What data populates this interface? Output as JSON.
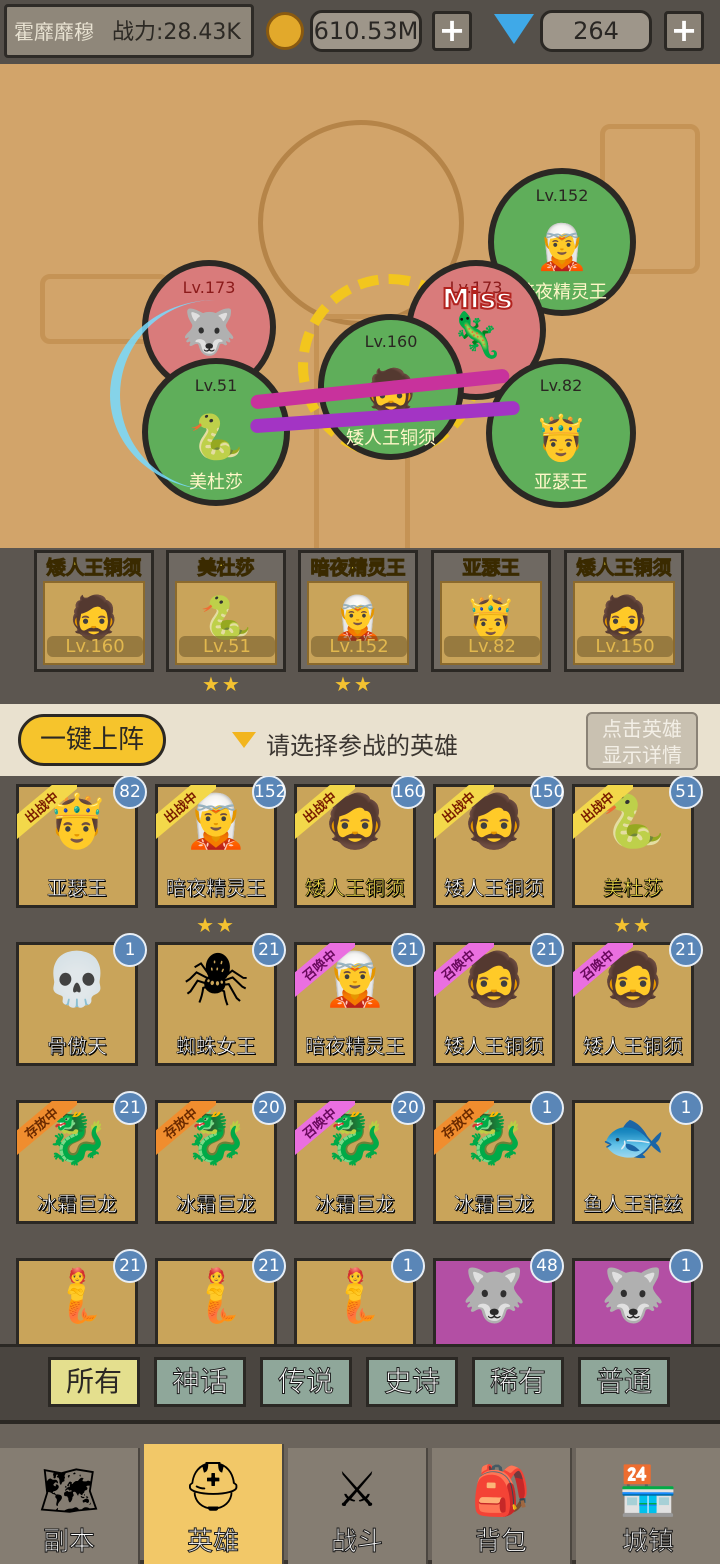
{
  "topbar": {
    "player_name": "霍靡靡穆",
    "power": "战力:28.43K",
    "gold": "610.53M",
    "gems": "264",
    "plus": "+"
  },
  "battle": {
    "units": [
      {
        "level": "Lv.173",
        "name": "",
        "icon": "werewolf",
        "color": "#d97b7b"
      },
      {
        "level": "Lv.152",
        "name": "暗夜精灵王",
        "icon": "dark-elf-king",
        "color": "#5fae5a"
      },
      {
        "level": "Lv.173",
        "name": "",
        "icon": "lizard",
        "color": "#d97b7b"
      },
      {
        "level": "Lv.160",
        "name": "矮人王铜须",
        "icon": "dwarf-king",
        "color": "#5fae5a"
      },
      {
        "level": "Lv.51",
        "name": "美杜莎",
        "icon": "medusa",
        "color": "#5fae5a"
      },
      {
        "level": "Lv.82",
        "name": "亚瑟王",
        "icon": "king-arthur",
        "color": "#5fae5a"
      }
    ],
    "miss_text": "Miss"
  },
  "team": [
    {
      "name": "矮人王铜须",
      "level": "Lv.160",
      "stars": ""
    },
    {
      "name": "美杜莎",
      "level": "Lv.51",
      "stars": "★★"
    },
    {
      "name": "暗夜精灵王",
      "level": "Lv.152",
      "stars": "★★"
    },
    {
      "name": "亚瑟王",
      "level": "Lv.82",
      "stars": ""
    },
    {
      "name": "矮人王铜须",
      "level": "Lv.150",
      "stars": ""
    }
  ],
  "actions": {
    "deploy_label": "一键上阵",
    "hint": "请选择参战的英雄",
    "detail_line1": "点击英雄",
    "detail_line2": "显示详情"
  },
  "heroes": [
    {
      "name": "亚瑟王",
      "level": "82",
      "status": "出战中",
      "stars": ""
    },
    {
      "name": "暗夜精灵王",
      "level": "152",
      "status": "出战中",
      "stars": "★★"
    },
    {
      "name": "矮人王铜须",
      "level": "160",
      "status": "出战中",
      "stars": ""
    },
    {
      "name": "矮人王铜须",
      "level": "150",
      "status": "出战中",
      "stars": ""
    },
    {
      "name": "美杜莎",
      "level": "51",
      "status": "出战中",
      "stars": "★★"
    },
    {
      "name": "骨傲天",
      "level": "1",
      "status": "",
      "stars": ""
    },
    {
      "name": "蜘蛛女王",
      "level": "21",
      "status": "",
      "stars": ""
    },
    {
      "name": "暗夜精灵王",
      "level": "21",
      "status": "召唤中",
      "stars": ""
    },
    {
      "name": "矮人王铜须",
      "level": "21",
      "status": "召唤中",
      "stars": ""
    },
    {
      "name": "矮人王铜须",
      "level": "21",
      "status": "召唤中",
      "stars": ""
    },
    {
      "name": "冰霜巨龙",
      "level": "21",
      "status": "存放中",
      "stars": ""
    },
    {
      "name": "冰霜巨龙",
      "level": "20",
      "status": "存放中",
      "stars": ""
    },
    {
      "name": "冰霜巨龙",
      "level": "20",
      "status": "召唤中",
      "stars": ""
    },
    {
      "name": "冰霜巨龙",
      "level": "1",
      "status": "存放中",
      "stars": ""
    },
    {
      "name": "鱼人王菲兹",
      "level": "1",
      "status": "",
      "stars": ""
    },
    {
      "name": "",
      "level": "21",
      "status": "",
      "stars": ""
    },
    {
      "name": "",
      "level": "21",
      "status": "",
      "stars": ""
    },
    {
      "name": "",
      "level": "1",
      "status": "",
      "stars": ""
    },
    {
      "name": "",
      "level": "48",
      "status": "",
      "stars": ""
    },
    {
      "name": "",
      "level": "1",
      "status": "",
      "stars": ""
    }
  ],
  "filters": [
    "所有",
    "神话",
    "传说",
    "史诗",
    "稀有",
    "普通"
  ],
  "nav": [
    {
      "label": "副本",
      "icon": "map-icon"
    },
    {
      "label": "英雄",
      "icon": "helmet-icon"
    },
    {
      "label": "战斗",
      "icon": "crossed-swords-icon"
    },
    {
      "label": "背包",
      "icon": "backpack-icon"
    },
    {
      "label": "城镇",
      "icon": "shop-icon"
    }
  ],
  "colors": {
    "accent": "#f6c42c",
    "gold_text": "#f5e04a",
    "panel": "#5c5650"
  }
}
